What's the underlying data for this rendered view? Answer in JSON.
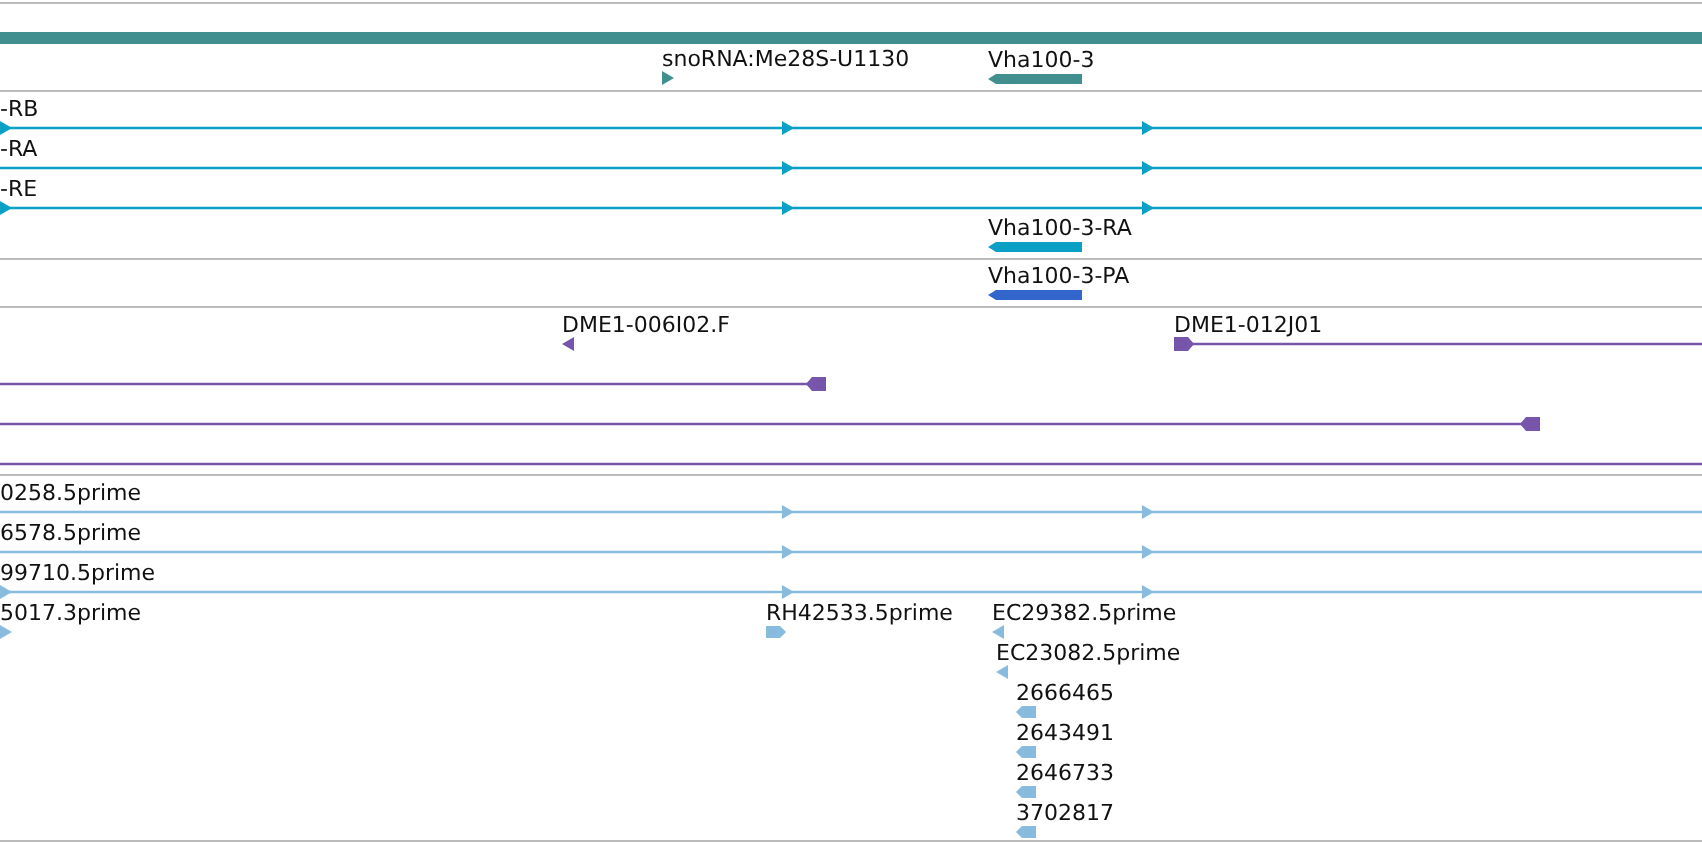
{
  "tracks": [
    {
      "kind": "gene",
      "features": [
        {
          "kind": "bar"
        },
        {
          "kind": "tick",
          "label": "snoRNA:Me28S-U1130",
          "reverse": false
        },
        {
          "kind": "bar",
          "label": "Vha100-3",
          "reverse": true
        }
      ]
    },
    {
      "kind": "transcript",
      "features": [
        {
          "kind": "line",
          "label": "-RB",
          "reverse": false
        },
        {
          "kind": "line",
          "label": "-RA",
          "reverse": false
        },
        {
          "kind": "line",
          "label": "-RE",
          "reverse": false
        },
        {
          "kind": "bar",
          "label": "Vha100-3-RA",
          "reverse": true
        }
      ]
    },
    {
      "kind": "protein",
      "features": [
        {
          "kind": "bar",
          "label": "Vha100-3-PA",
          "reverse": true
        }
      ]
    },
    {
      "kind": "clone",
      "features": [
        {
          "kind": "tick",
          "label": "DME1-006I02.F",
          "reverse": true
        },
        {
          "kind": "line",
          "label": "DME1-012J01",
          "reverse": false
        },
        {
          "kind": "line",
          "reverse": true
        },
        {
          "kind": "line",
          "reverse": true
        },
        {
          "kind": "line"
        }
      ]
    },
    {
      "kind": "est",
      "features": [
        {
          "kind": "line",
          "label": "0258.5prime",
          "reverse": false
        },
        {
          "kind": "line",
          "label": "6578.5prime",
          "reverse": false
        },
        {
          "kind": "line",
          "label": "99710.5prime",
          "reverse": false
        },
        {
          "kind": "tick",
          "label": "5017.3prime",
          "reverse": false
        },
        {
          "kind": "block",
          "label": "RH42533.5prime",
          "reverse": false
        },
        {
          "kind": "tick",
          "label": "EC29382.5prime",
          "reverse": true
        },
        {
          "kind": "tick",
          "label": "EC23082.5prime",
          "reverse": true
        },
        {
          "kind": "block",
          "label": "2666465",
          "reverse": true
        },
        {
          "kind": "block",
          "label": "2643491",
          "reverse": true
        },
        {
          "kind": "block",
          "label": "2646733",
          "reverse": true
        },
        {
          "kind": "block",
          "label": "3702817",
          "reverse": true
        }
      ]
    }
  ]
}
